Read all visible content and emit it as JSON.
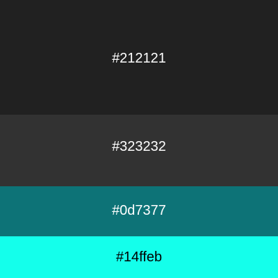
{
  "swatches": [
    {
      "label": "#212121",
      "color": "#212121",
      "text_color": "#ffffff"
    },
    {
      "label": "#323232",
      "color": "#323232",
      "text_color": "#ffffff"
    },
    {
      "label": "#0d7377",
      "color": "#0d7377",
      "text_color": "#ffffff"
    },
    {
      "label": "#14ffeb",
      "color": "#14ffeb",
      "text_color": "#000000"
    }
  ]
}
